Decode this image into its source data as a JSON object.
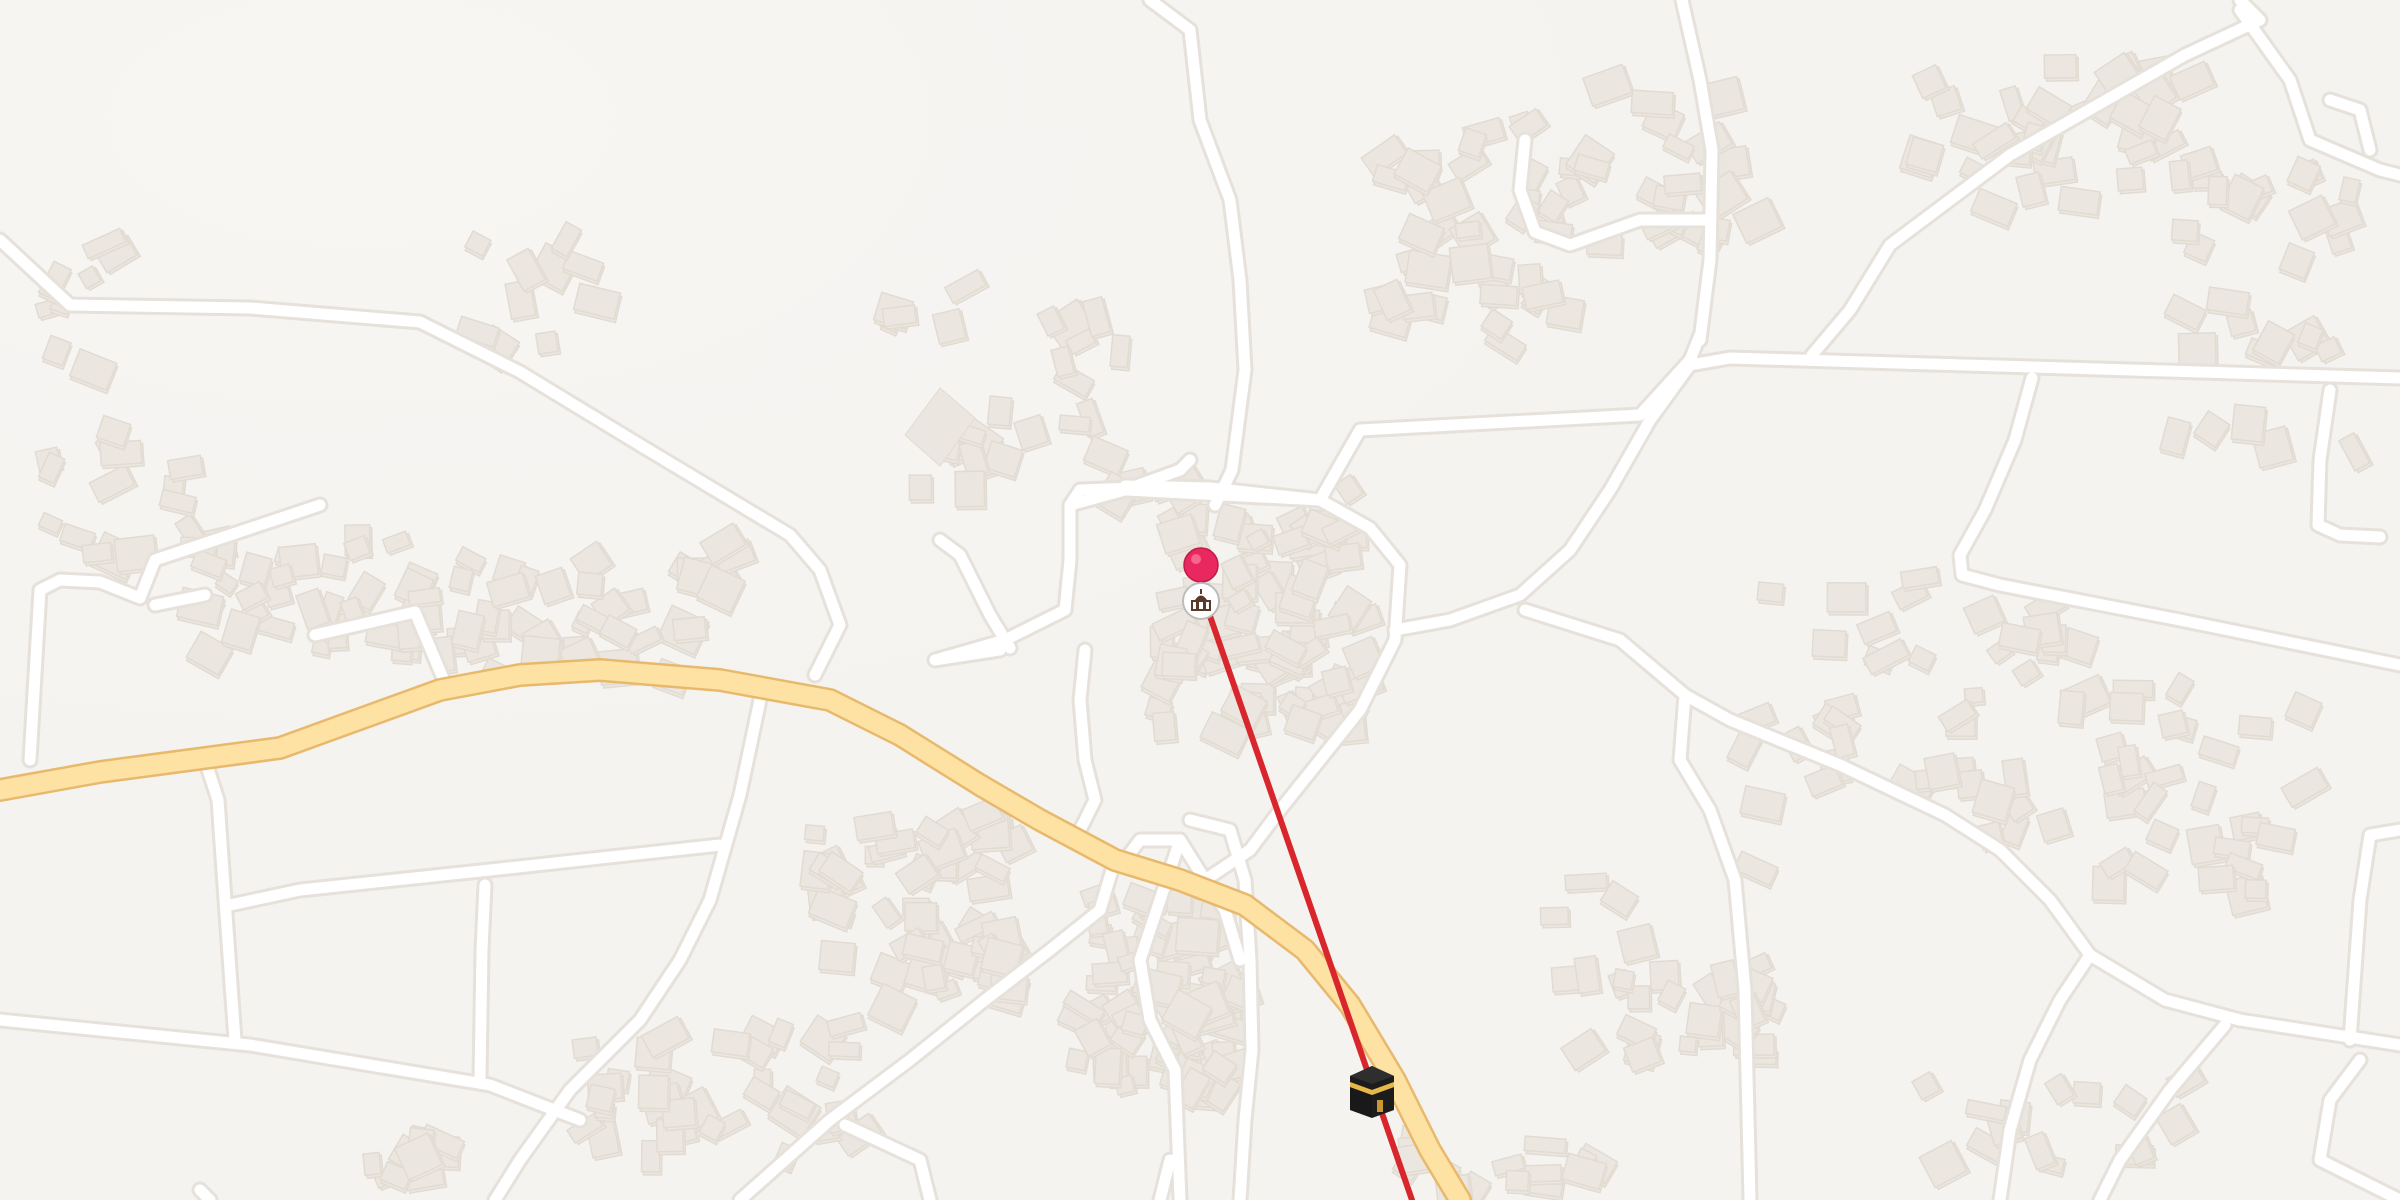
{
  "map": {
    "background_color": "#f5f3f0",
    "road_color": "#ffffff",
    "main_road_color": "#fde2a4",
    "building_color": "#ebe6df",
    "qibla_line_color": "#d8262c",
    "location_pin_color": "#e8285e",
    "origin_icon": "mosque-icon",
    "destination_icon": "kaaba-icon"
  }
}
